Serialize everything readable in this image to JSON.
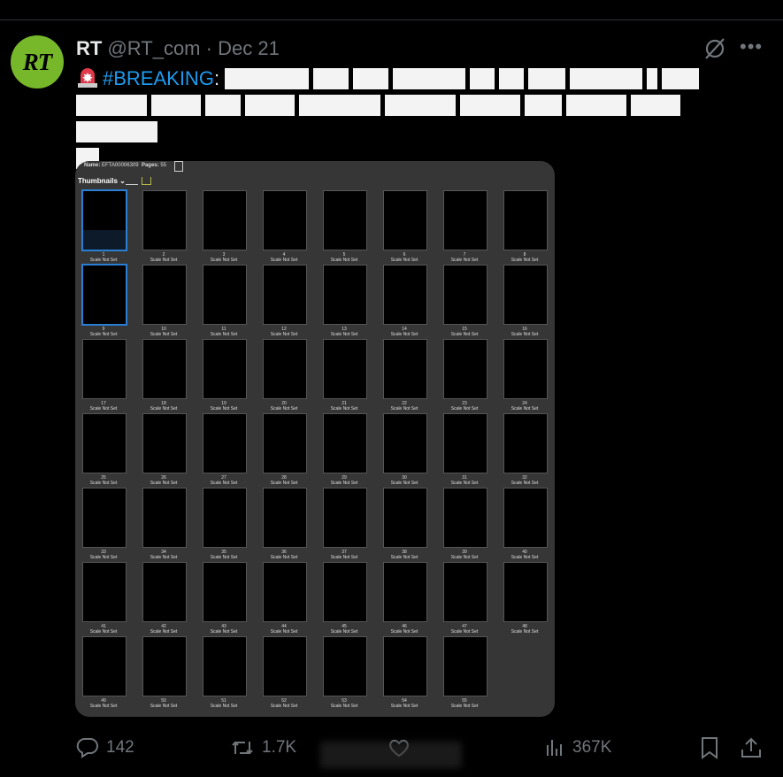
{
  "tweet": {
    "author_name": "RT",
    "handle": "@RT_com",
    "separator": "·",
    "date": "Dec 21",
    "avatar_text": "RT",
    "hashtag": "#BREAKING",
    "colon": ":"
  },
  "media": {
    "name_label": "Name:",
    "name_value": "EFTA00006309",
    "pages_label": "Pages:",
    "pages_value": "55",
    "panel_title": "Thumbnails",
    "scale_text": "Scale Not Set"
  },
  "actions": {
    "replies": "142",
    "reposts": "1.7K",
    "views": "367K"
  },
  "colors": {
    "accent": "#1d9bf0",
    "avatar_bg": "#77b82a",
    "selection": "#2a7fd4"
  }
}
